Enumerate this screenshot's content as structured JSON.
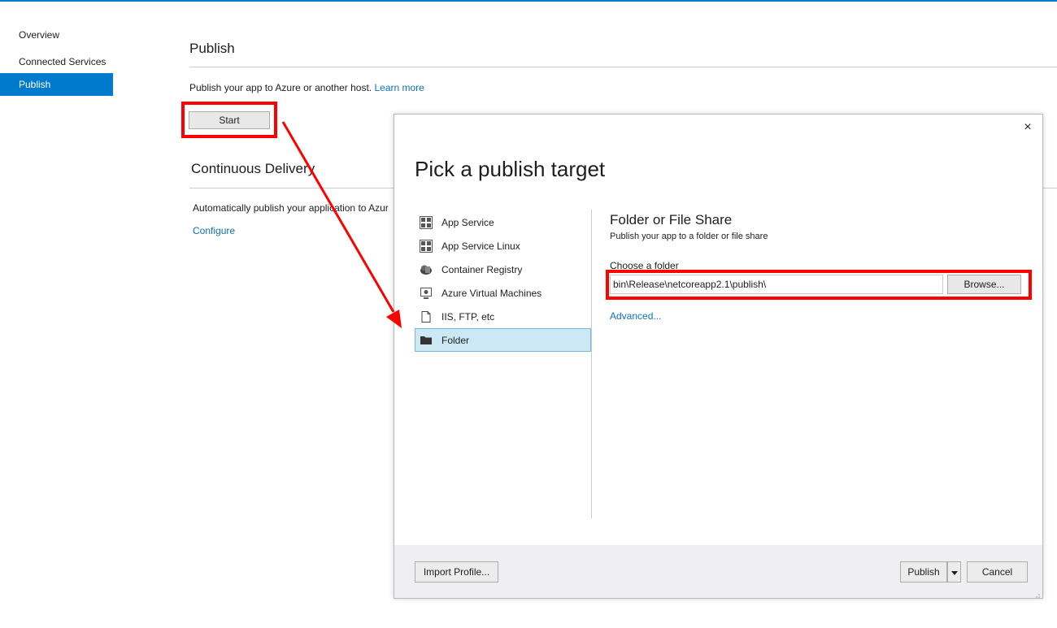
{
  "nav": {
    "items": [
      {
        "label": "Overview",
        "active": false
      },
      {
        "label": "Connected Services",
        "active": false
      },
      {
        "label": "Publish",
        "active": true
      }
    ]
  },
  "main": {
    "publish_heading": "Publish",
    "publish_description": "Publish your app to Azure or another host.",
    "learn_more": "Learn more",
    "start_button": "Start",
    "cd_heading": "Continuous Delivery",
    "cd_description": "Automatically publish your application to Azur",
    "configure_link": "Configure"
  },
  "dialog": {
    "close": "×",
    "title": "Pick a publish target",
    "targets": [
      {
        "label": "App Service",
        "icon": "app-service-icon",
        "selected": false
      },
      {
        "label": "App Service Linux",
        "icon": "app-service-linux-icon",
        "selected": false
      },
      {
        "label": "Container Registry",
        "icon": "container-registry-icon",
        "selected": false
      },
      {
        "label": "Azure Virtual Machines",
        "icon": "virtual-machine-icon",
        "selected": false
      },
      {
        "label": "IIS, FTP, etc",
        "icon": "document-icon",
        "selected": false
      },
      {
        "label": "Folder",
        "icon": "folder-icon",
        "selected": true
      }
    ],
    "panel": {
      "title": "Folder or File Share",
      "subtitle": "Publish your app to a folder or file share",
      "folder_label": "Choose a folder",
      "folder_value": "bin\\Release\\netcoreapp2.1\\publish\\",
      "browse_button": "Browse...",
      "advanced_link": "Advanced..."
    },
    "footer": {
      "import_profile": "Import Profile...",
      "publish": "Publish",
      "cancel": "Cancel"
    }
  },
  "colors": {
    "accent": "#007acc",
    "link": "#0e70c0",
    "highlight": "#ff0000",
    "selected_bg": "#cce8f4"
  }
}
